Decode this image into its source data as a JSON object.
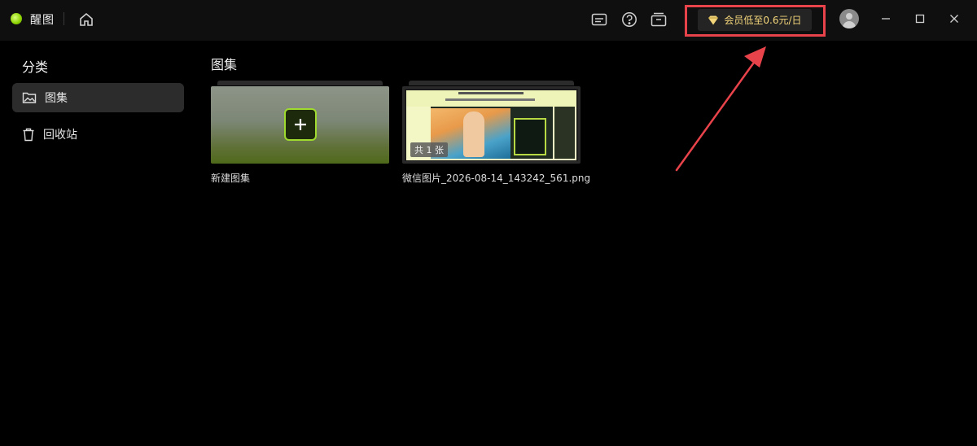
{
  "app": {
    "name": "醒图"
  },
  "vip": {
    "label": "会员低至0.6元/日",
    "color": "#f3d57a",
    "highlight_color": "#e8434a"
  },
  "sidebar": {
    "title": "分类",
    "items": [
      {
        "label": "图集",
        "icon": "gallery-icon",
        "active": true
      },
      {
        "label": "回收站",
        "icon": "trash-icon",
        "active": false
      }
    ]
  },
  "main": {
    "title": "图集",
    "cards": [
      {
        "caption": "新建图集",
        "type": "new"
      },
      {
        "caption": "微信图片_2026-08-14_143242_561.png",
        "badge": "共 1 张",
        "type": "image"
      }
    ]
  },
  "icons": [
    "home-icon",
    "subtitle-icon",
    "help-icon",
    "box-icon",
    "diamond-icon",
    "minimize-icon",
    "maximize-icon",
    "close-icon"
  ],
  "accent": "#9edb2e"
}
